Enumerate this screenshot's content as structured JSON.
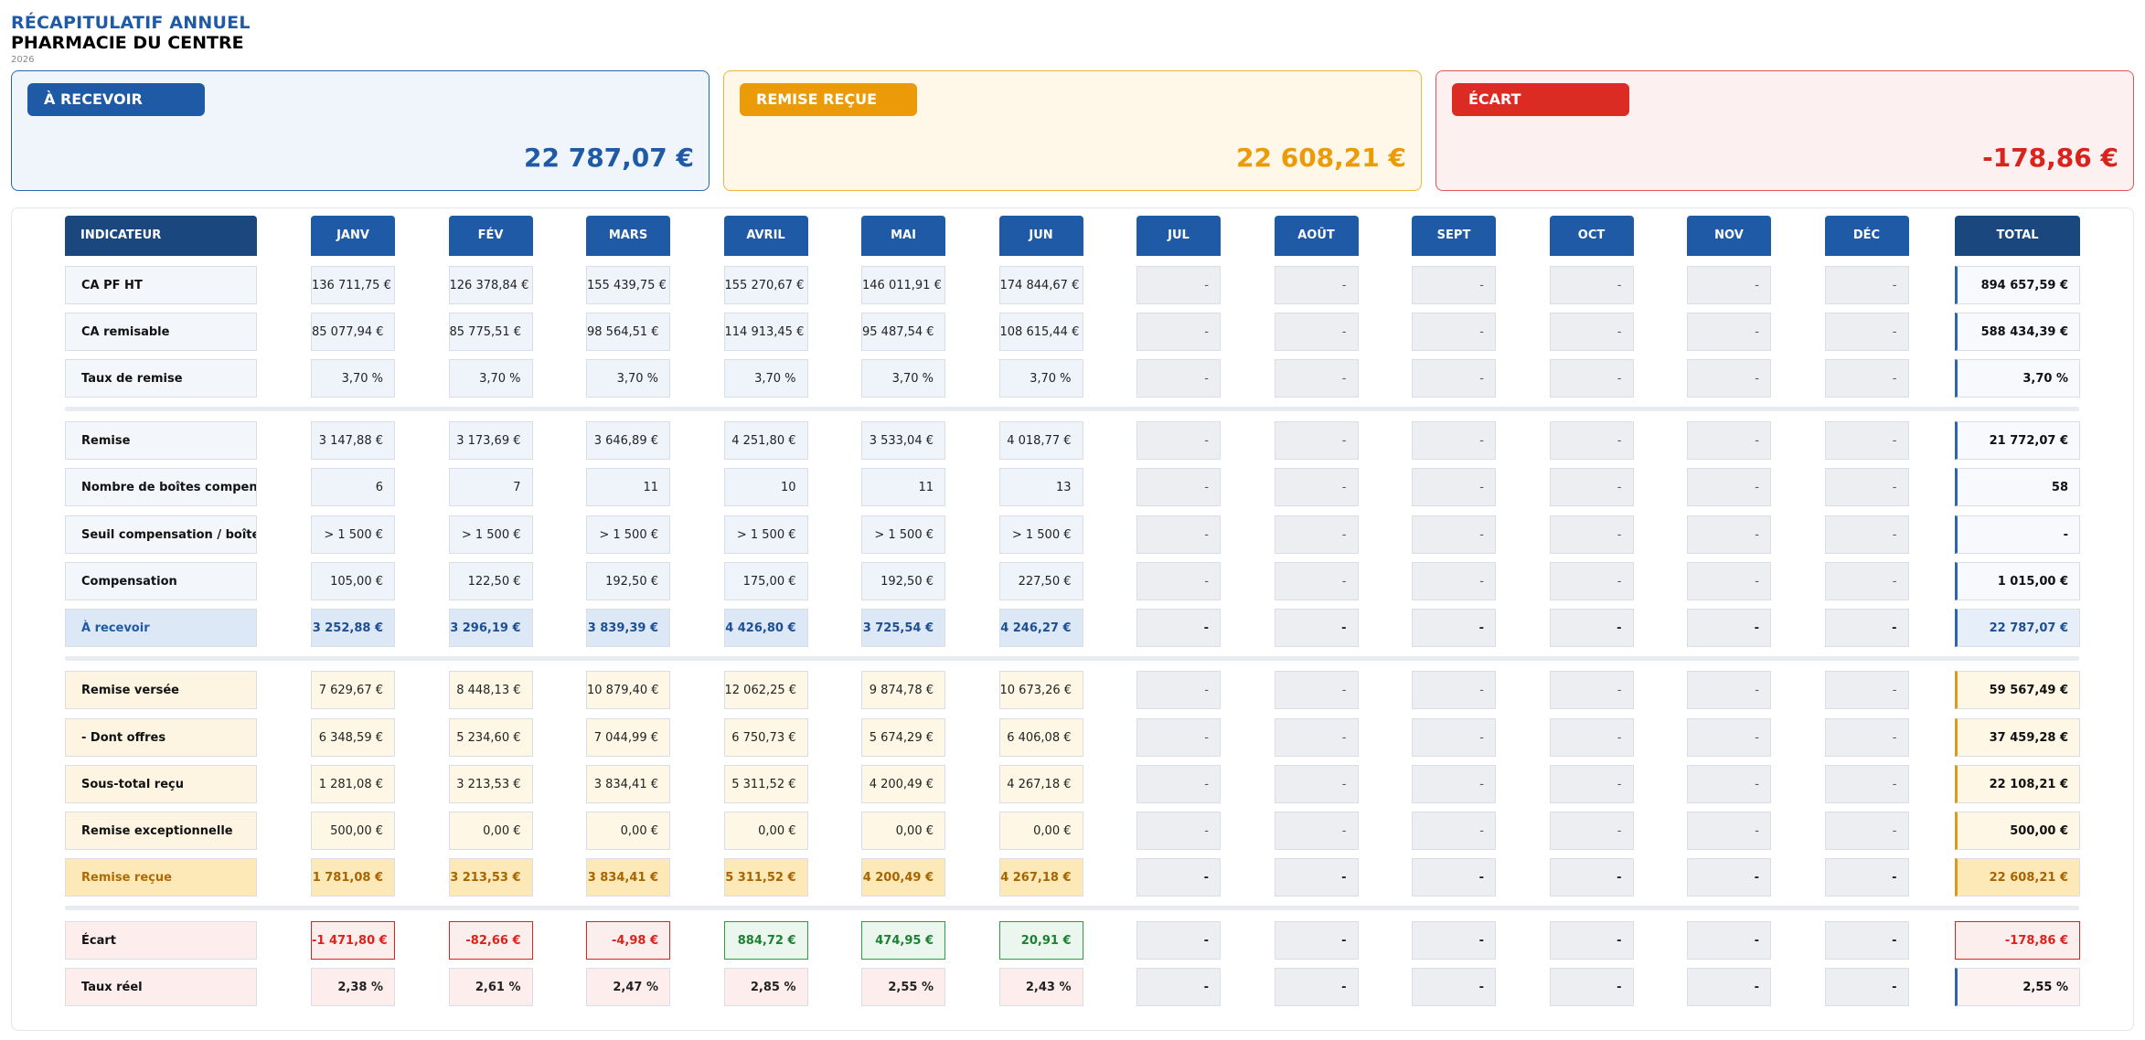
{
  "header": {
    "title": "RÉCAPITULATIF ANNUEL",
    "pharmacy": "PHARMACIE DU CENTRE",
    "year": "2026"
  },
  "cards": [
    {
      "label": "À RECEVOIR",
      "amount": "22 787,07 €"
    },
    {
      "label": "REMISE REÇUE",
      "amount": "22 608,21 €"
    },
    {
      "label": "ÉCART",
      "amount": "-178,86 €"
    }
  ],
  "table": {
    "indicator_header": "INDICATEUR",
    "months": [
      "JANV",
      "FÉV",
      "MARS",
      "AVRIL",
      "MAI",
      "JUN",
      "JUL",
      "AOÛT",
      "SEPT",
      "OCT",
      "NOV",
      "DÉC"
    ],
    "total_header": "TOTAL",
    "empty_value": "-",
    "groups": [
      {
        "id": "g1",
        "rows": [
          {
            "label": "CA PF HT",
            "values": [
              "136 711,75 €",
              "126 378,84 €",
              "155 439,75 €",
              "155 270,67 €",
              "146 011,91 €",
              "174 844,67 €"
            ],
            "total": "894 657,59 €"
          },
          {
            "label": "CA remisable",
            "values": [
              "85 077,94 €",
              "85 775,51 €",
              "98 564,51 €",
              "114 913,45 €",
              "95 487,54 €",
              "108 615,44 €"
            ],
            "total": "588 434,39 €"
          },
          {
            "label": "Taux de remise",
            "values": [
              "3,70 %",
              "3,70 %",
              "3,70 %",
              "3,70 %",
              "3,70 %",
              "3,70 %"
            ],
            "total": "3,70 %"
          }
        ]
      },
      {
        "id": "g1b",
        "rows": [
          {
            "label": "Remise",
            "values": [
              "3 147,88 €",
              "3 173,69 €",
              "3 646,89 €",
              "4 251,80 €",
              "3 533,04 €",
              "4 018,77 €"
            ],
            "total": "21 772,07 €"
          },
          {
            "label": "Nombre de boîtes compensées",
            "values": [
              "6",
              "7",
              "11",
              "10",
              "11",
              "13"
            ],
            "total": "58"
          },
          {
            "label": "Seuil compensation / boîte",
            "values": [
              "> 1 500 €",
              "> 1 500 €",
              "> 1 500 €",
              "> 1 500 €",
              "> 1 500 €",
              "> 1 500 €"
            ],
            "total": "-"
          },
          {
            "label": "Compensation",
            "values": [
              "105,00 €",
              "122,50 €",
              "192,50 €",
              "175,00 €",
              "192,50 €",
              "227,50 €"
            ],
            "total": "1 015,00 €"
          },
          {
            "label": "À recevoir",
            "values": [
              "3 252,88 €",
              "3 296,19 €",
              "3 839,39 €",
              "4 426,80 €",
              "3 725,54 €",
              "4 246,27 €"
            ],
            "total": "22 787,07 €",
            "summary": true
          }
        ]
      },
      {
        "id": "g2",
        "rows": [
          {
            "label": "Remise versée",
            "values": [
              "7 629,67 €",
              "8 448,13 €",
              "10 879,40 €",
              "12 062,25 €",
              "9 874,78 €",
              "10 673,26 €"
            ],
            "total": "59 567,49 €"
          },
          {
            "label": "- Dont offres",
            "values": [
              "6 348,59 €",
              "5 234,60 €",
              "7 044,99 €",
              "6 750,73 €",
              "5 674,29 €",
              "6 406,08 €"
            ],
            "total": "37 459,28 €"
          },
          {
            "label": "Sous-total reçu",
            "values": [
              "1 281,08 €",
              "3 213,53 €",
              "3 834,41 €",
              "5 311,52 €",
              "4 200,49 €",
              "4 267,18 €"
            ],
            "total": "22 108,21 €"
          },
          {
            "label": "Remise exceptionnelle",
            "values": [
              "500,00 €",
              "0,00 €",
              "0,00 €",
              "0,00 €",
              "0,00 €",
              "0,00 €"
            ],
            "total": "500,00 €"
          },
          {
            "label": "Remise reçue",
            "values": [
              "1 781,08 €",
              "3 213,53 €",
              "3 834,41 €",
              "5 311,52 €",
              "4 200,49 €",
              "4 267,18 €"
            ],
            "total": "22 608,21 €",
            "summary": true
          }
        ]
      },
      {
        "id": "g3",
        "rows": [
          {
            "label": "Écart",
            "values": [
              "-1 471,80 €",
              "-82,66 €",
              "-4,98 €",
              "884,72 €",
              "474,95 €",
              "20,91 €"
            ],
            "total": "-178,86 €",
            "signed": true
          },
          {
            "label": "Taux réel",
            "values": [
              "2,38 %",
              "2,61 %",
              "2,47 %",
              "2,85 %",
              "2,55 %",
              "2,43 %"
            ],
            "total": "2,55 %"
          }
        ]
      }
    ]
  },
  "colors": {
    "blue": "#1f5aa6",
    "orange": "#eb9a08",
    "red": "#dc2b23",
    "green": "#1e7e34"
  }
}
